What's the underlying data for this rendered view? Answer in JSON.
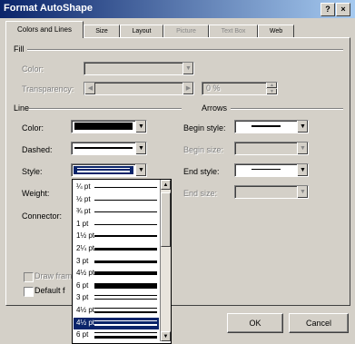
{
  "window": {
    "title": "Format AutoShape",
    "help_btn": "?",
    "close_btn": "×"
  },
  "tabs": [
    {
      "label": "Colors and Lines",
      "active": true
    },
    {
      "label": "Size",
      "active": false
    },
    {
      "label": "Layout",
      "active": false
    },
    {
      "label": "Picture",
      "active": false,
      "disabled": true
    },
    {
      "label": "Text Box",
      "active": false,
      "disabled": true
    },
    {
      "label": "Web",
      "active": false
    }
  ],
  "fill": {
    "section": "Fill",
    "color_label": "Color:",
    "transparency_label": "Transparency:",
    "transparency_value": "0 %"
  },
  "line": {
    "section": "Line",
    "color_label": "Color:",
    "dashed_label": "Dashed:",
    "style_label": "Style:",
    "weight_label": "Weight:",
    "connector_label": "Connector:",
    "color_value": "#000000"
  },
  "arrows": {
    "section": "Arrows",
    "begin_style_label": "Begin style:",
    "begin_size_label": "Begin size:",
    "end_style_label": "End style:",
    "end_size_label": "End size:"
  },
  "checkboxes": {
    "draw_frame": "Draw fram",
    "default": "Default f"
  },
  "buttons": {
    "ok": "OK",
    "cancel": "Cancel"
  },
  "style_options": [
    {
      "label": "¼ pt",
      "weight": 1
    },
    {
      "label": "½ pt",
      "weight": 1
    },
    {
      "label": "¾ pt",
      "weight": 1
    },
    {
      "label": "1 pt",
      "weight": 1
    },
    {
      "label": "1½ pt",
      "weight": 2
    },
    {
      "label": "2¼ pt",
      "weight": 3
    },
    {
      "label": "3 pt",
      "weight": 3
    },
    {
      "label": "4½ pt",
      "weight": 4
    },
    {
      "label": "6 pt",
      "weight": 6
    },
    {
      "label": "3 pt",
      "weight": 3,
      "double": true
    },
    {
      "label": "4½ pt",
      "weight": 4,
      "double": true
    },
    {
      "label": "4½ pt",
      "weight": 4,
      "double": true,
      "selected": true
    },
    {
      "label": "6 pt",
      "weight": 5,
      "double": true
    }
  ]
}
